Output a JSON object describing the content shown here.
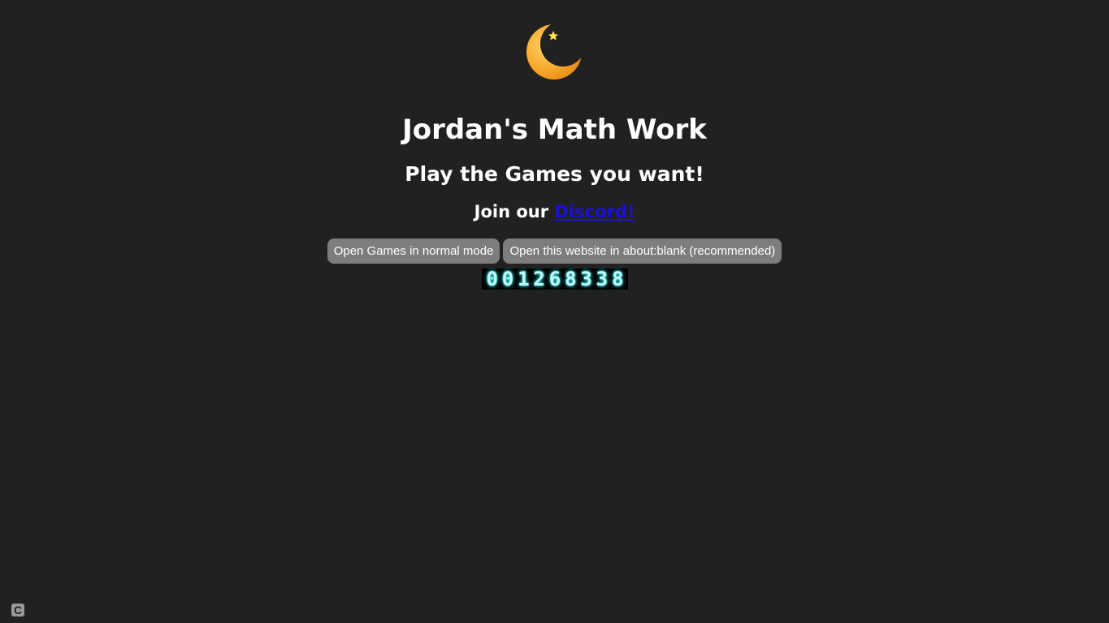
{
  "header": {
    "title": "Jordan's Math Work",
    "subtitle": "Play the Games you want!",
    "join_prefix": "Join our ",
    "discord_link_label": "Discord!"
  },
  "logo": {
    "icon": "crescent-moon-with-star-icon",
    "moon_color": "#f5a623",
    "star_color": "#ffe14d"
  },
  "buttons": {
    "normal_mode_label": "Open Games in normal mode",
    "about_blank_label": "Open this website in about:blank (recommended)"
  },
  "visitor_counter": {
    "digits": [
      "0",
      "0",
      "1",
      "2",
      "6",
      "8",
      "3",
      "3",
      "8"
    ],
    "value": "001268338",
    "glow_color": "#2ee6e6"
  },
  "corner_widget": {
    "label": "C",
    "icon": "c-badge-icon"
  },
  "colors": {
    "background": "#212121",
    "text": "#ffffff",
    "button_bg": "#7d7d7d",
    "link": "#1a10d8"
  }
}
